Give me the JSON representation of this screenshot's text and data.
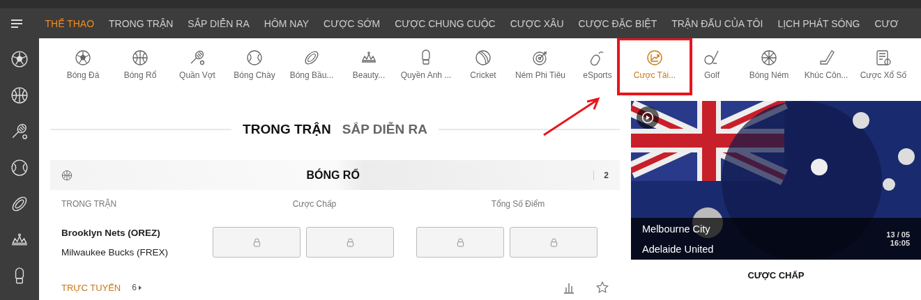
{
  "top_menu": [
    {
      "label": "THẾ THAO",
      "selected": true
    },
    {
      "label": "TRONG TRẬN",
      "selected": false
    },
    {
      "label": "SẮP DIỄN RA",
      "selected": false
    },
    {
      "label": "HÔM NAY",
      "selected": false
    },
    {
      "label": "CƯỢC SỚM",
      "selected": false
    },
    {
      "label": "CƯỢC CHUNG CUỘC",
      "selected": false
    },
    {
      "label": "CƯỢC XÂU",
      "selected": false
    },
    {
      "label": "CƯỢC ĐẶC BIỆT",
      "selected": false
    },
    {
      "label": "TRẬN ĐẤU CỦA TÔI",
      "selected": false
    },
    {
      "label": "LỊCH PHÁT SÓNG",
      "selected": false
    },
    {
      "label": "CƯƠ",
      "selected": false
    }
  ],
  "sports": [
    {
      "label": "Bóng Đá",
      "selected": false,
      "highlighted": false
    },
    {
      "label": "Bóng Rổ",
      "selected": false,
      "highlighted": false
    },
    {
      "label": "Quần Vợt",
      "selected": false,
      "highlighted": false
    },
    {
      "label": "Bóng Chày",
      "selected": false,
      "highlighted": false
    },
    {
      "label": "Bóng Bầu...",
      "selected": false,
      "highlighted": false
    },
    {
      "label": "Beauty...",
      "selected": false,
      "highlighted": false
    },
    {
      "label": "Quyền Anh ...",
      "selected": false,
      "highlighted": false
    },
    {
      "label": "Cricket",
      "selected": false,
      "highlighted": false
    },
    {
      "label": "Ném Phi Tiêu",
      "selected": false,
      "highlighted": false
    },
    {
      "label": "eSports",
      "selected": false,
      "highlighted": false
    },
    {
      "label": "Cược Tài...",
      "selected": true,
      "highlighted": true
    },
    {
      "label": "Golf",
      "selected": false,
      "highlighted": false
    },
    {
      "label": "Bóng Ném",
      "selected": false,
      "highlighted": false
    },
    {
      "label": "Khúc Côn...",
      "selected": false,
      "highlighted": false
    },
    {
      "label": "Cược Xổ Số",
      "selected": false,
      "highlighted": false
    }
  ],
  "match_tabs": [
    {
      "label": "TRONG TRẬN",
      "selected": true
    },
    {
      "label": "SẮP DIỄN RA",
      "selected": false
    }
  ],
  "section": {
    "title": "BÓNG RỔ",
    "count": "2",
    "columns": [
      "TRONG TRẬN",
      "Cược Chấp",
      "Tổng Số Điểm"
    ],
    "teams": [
      {
        "name": "Brooklyn Nets (OREZ)",
        "bold": true
      },
      {
        "name": "Milwaukee Bucks (FREX)",
        "bold": false
      }
    ],
    "odds": [
      {
        "locked": true
      },
      {
        "locked": true
      },
      {
        "locked": true
      },
      {
        "locked": true
      }
    ],
    "live_label": "TRỰC TUYẾN",
    "live_count": "6"
  },
  "featured": {
    "home": "Melbourne City",
    "away": "Adelaide United",
    "date": "13 / 05",
    "time": "16:05",
    "market": "CƯỢC CHẤP"
  }
}
